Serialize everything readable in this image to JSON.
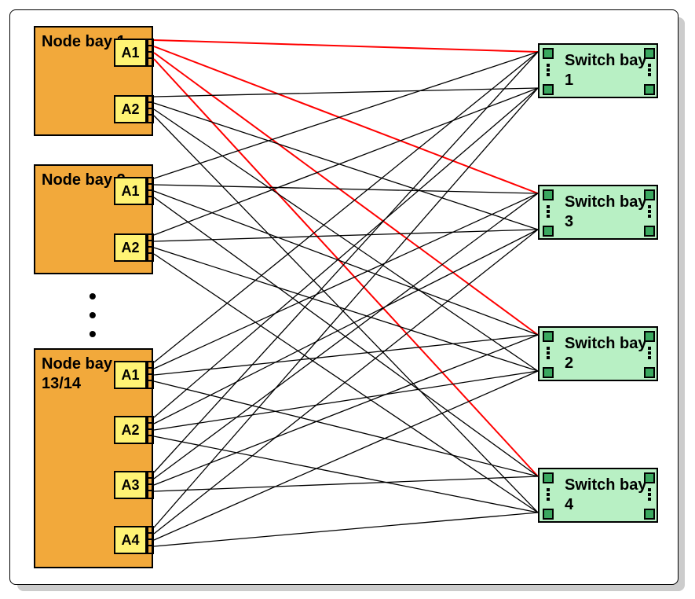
{
  "nodeBays": [
    {
      "id": "nb1",
      "label": "Node\nbay 1",
      "adapters": [
        "A1",
        "A2"
      ]
    },
    {
      "id": "nb2",
      "label": "Node\nbay 2",
      "adapters": [
        "A1",
        "A2"
      ]
    },
    {
      "id": "nb3",
      "label": "Node\nbay\n13/14",
      "adapters": [
        "A1",
        "A2",
        "A3",
        "A4"
      ]
    }
  ],
  "switchBays": [
    {
      "id": "sb1",
      "label": "Switch\nbay 1"
    },
    {
      "id": "sb3",
      "label": "Switch\nbay 3"
    },
    {
      "id": "sb2",
      "label": "Switch\nbay 2"
    },
    {
      "id": "sb4",
      "label": "Switch\nbay 4"
    }
  ],
  "connections": {
    "description": "Each adapter has 4 ports, one to each switch bay; adapter A1 of Node bay 1 shown highlighted in red (4 lines).",
    "highlightedAdapter": "Node bay 1 / A1",
    "switchTargetsPerAdapter": [
      "Switch bay 1",
      "Switch bay 2",
      "Switch bay 3",
      "Switch bay 4"
    ],
    "colors": {
      "normal": "#000000",
      "highlight": "#ff0000"
    }
  }
}
